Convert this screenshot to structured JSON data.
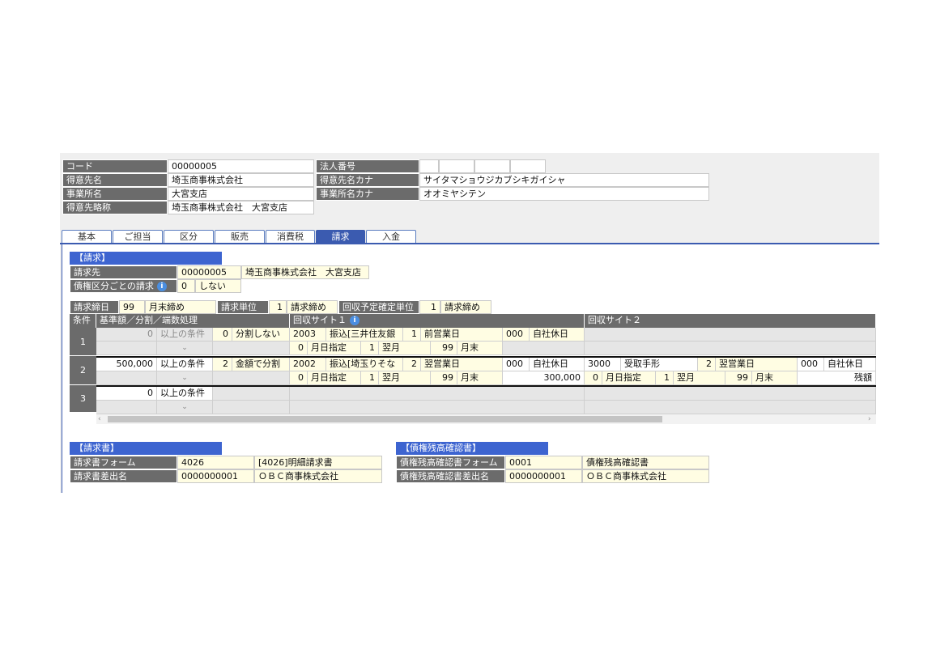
{
  "top": {
    "code_label": "コード",
    "code_value": "00000005",
    "name_label": "得意先名",
    "name_value": "埼玉商事株式会社",
    "office_label": "事業所名",
    "office_value": "大宮支店",
    "abbr_label": "得意先略称",
    "abbr_value": "埼玉商事株式会社　大宮支店",
    "corp_label": "法人番号",
    "kana_label": "得意先名カナ",
    "kana_value": "サイタマショウジカブシキガイシャ",
    "office_kana_label": "事業所名カナ",
    "office_kana_value": "オオミヤシテン"
  },
  "tabs": [
    "基本",
    "ご担当",
    "区分",
    "販売",
    "消費税",
    "請求",
    "入金"
  ],
  "active_tab": "請求",
  "billing": {
    "section_title": "【請求】",
    "billto_label": "請求先",
    "billto_code": "00000005",
    "billto_name": "埼玉商事株式会社　大宮支店",
    "perclass_label": "債権区分ごとの請求",
    "perclass_code": "0",
    "perclass_value": "しない",
    "closing_label": "請求締日",
    "closing_code": "99",
    "closing_value": "月末締め",
    "unit_label": "請求単位",
    "unit_code": "1",
    "unit_value": "請求締め",
    "plan_label": "回収予定確定単位",
    "plan_code": "1",
    "plan_value": "請求締め"
  },
  "grid": {
    "h_cond": "条件",
    "h_base": "基準額／分割／端数処理",
    "h_site1": "回収サイト１",
    "h_site2": "回収サイト２",
    "rows": [
      {
        "no": "1",
        "amount": "0",
        "cond": "以上の条件",
        "split_code": "0",
        "split": "分割しない",
        "s1_code": "2003",
        "s1_method": "振込[三井住友銀",
        "s1_day_code": "1",
        "s1_day": "前営業日",
        "s1_hol_code": "000",
        "s1_hol": "自社休日",
        "s1b_code": "0",
        "s1b_spec": "月日指定",
        "s1b_m_code": "1",
        "s1b_m": "翌月",
        "s1b_d_code": "99",
        "s1b_d": "月末"
      },
      {
        "no": "2",
        "amount": "500,000",
        "cond": "以上の条件",
        "split_code": "2",
        "split": "金額で分割",
        "s1_code": "2002",
        "s1_method": "振込[埼玉りそな",
        "s1_day_code": "2",
        "s1_day": "翌営業日",
        "s1_hol_code": "000",
        "s1_hol": "自社休日",
        "s1b_code": "0",
        "s1b_spec": "月日指定",
        "s1b_m_code": "1",
        "s1b_m": "翌月",
        "s1b_d_code": "99",
        "s1b_d": "月末",
        "s1_amount": "300,000",
        "s2_code": "3000",
        "s2_method": "受取手形",
        "s2_day_code": "2",
        "s2_day": "翌営業日",
        "s2_hol_code": "000",
        "s2_hol": "自社休日",
        "s2b_code": "0",
        "s2b_spec": "月日指定",
        "s2b_m_code": "1",
        "s2b_m": "翌月",
        "s2b_d_code": "99",
        "s2b_d": "月末",
        "s2_remain": "残額"
      },
      {
        "no": "3",
        "amount": "0",
        "cond": "以上の条件"
      }
    ]
  },
  "invoice": {
    "section_title": "【請求書】",
    "form_label": "請求書フォーム",
    "form_code": "4026",
    "form_value": "[4026]明細請求書",
    "sender_label": "請求書差出名",
    "sender_code": "0000000001",
    "sender_value": "ＯＢＣ商事株式会社"
  },
  "confirm": {
    "section_title": "【債権残高確認書】",
    "form_label": "債権残高確認書フォーム",
    "form_code": "0001",
    "form_value": "債権残高確認書",
    "sender_label": "債権残高確認書差出名",
    "sender_code": "0000000001",
    "sender_value": "ＯＢＣ商事株式会社"
  }
}
